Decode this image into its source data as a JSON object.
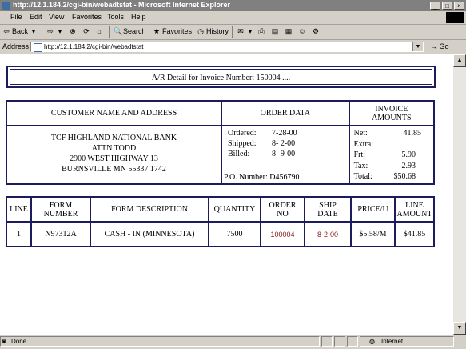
{
  "window": {
    "title": "http://12.1.184.2/cgi-bin/webadtstat - Microsoft Internet Explorer"
  },
  "menu": [
    "File",
    "Edit",
    "View",
    "Favorites",
    "Tools",
    "Help"
  ],
  "toolbar": {
    "back": "Back",
    "search": "Search",
    "favorites": "Favorites",
    "history": "History"
  },
  "address": {
    "label": "Address",
    "url": "http://12.1.184.2/cgi-bin/webadtstat",
    "go": "Go"
  },
  "page": {
    "header": "A/R Detail for Invoice Number: 150004 ....",
    "summary": {
      "customer_header": "CUSTOMER NAME AND ADDRESS",
      "order_header": "ORDER DATA",
      "invoice_header": [
        "INVOICE",
        "AMOUNTS"
      ],
      "customer_lines": [
        "TCF HIGHLAND NATIONAL BANK",
        "ATTN TODD",
        "2900 WEST HIGHWAY 13",
        "BURNSVILLE MN 55337 1742"
      ],
      "order": {
        "ordered_label": "Ordered:",
        "ordered_value": "7-28-00",
        "shipped_label": "Shipped:",
        "shipped_value": "8- 2-00",
        "billed_label": "Billed:",
        "billed_value": "8- 9-00",
        "po_label": "P.O. Number:",
        "po_value": "D456790"
      },
      "amounts": {
        "net_label": "Net:",
        "net_value": "41.85",
        "extra_label": "Extra:",
        "extra_value": "",
        "frt_label": "Frt:",
        "frt_value": "5.90",
        "tax_label": "Tax:",
        "tax_value": "2.93",
        "total_label": "Total:",
        "total_value": "$50.68"
      }
    },
    "lines": {
      "headers": {
        "line": "LINE",
        "form_number": [
          "FORM",
          "NUMBER"
        ],
        "form_description": "FORM DESCRIPTION",
        "quantity": "QUANTITY",
        "order_no": [
          "ORDER",
          "NO"
        ],
        "ship_date": [
          "SHIP",
          "DATE"
        ],
        "price": "PRICE/U",
        "line_amount": [
          "LINE",
          "AMOUNT"
        ]
      },
      "rows": [
        {
          "line": "1",
          "form_number": "N97312A",
          "form_description": "CASH - IN (MINNESOTA)",
          "quantity": "7500",
          "order_no": "100004",
          "ship_date": "8-2-00",
          "price": "$5.58/M",
          "line_amount": "$41.85"
        }
      ]
    }
  },
  "status": {
    "text": "Done",
    "zone": "Internet"
  }
}
